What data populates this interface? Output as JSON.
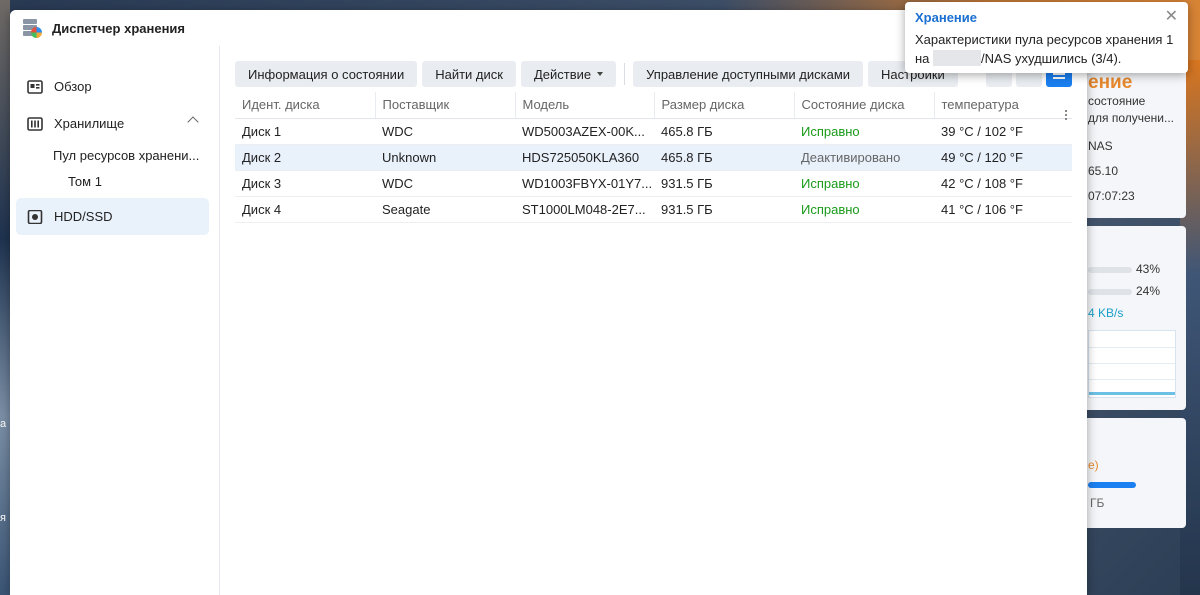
{
  "window": {
    "title": "Диспетчер хранения"
  },
  "sidebar": {
    "items": [
      {
        "label": "Обзор"
      },
      {
        "label": "Хранилище"
      },
      {
        "label": "Пул ресурсов хранени..."
      },
      {
        "label": "Том 1"
      },
      {
        "label": "HDD/SSD"
      }
    ]
  },
  "toolbar": {
    "status_info": "Информация о состоянии",
    "find_disk": "Найти диск",
    "action": "Действие",
    "manage_disks": "Управление доступными дисками",
    "settings": "Настройки"
  },
  "table": {
    "headers": [
      "Идент. диска",
      "Поставщик",
      "Модель",
      "Размер диска",
      "Состояние диска",
      "температура"
    ],
    "rows": [
      {
        "id": "Диск 1",
        "vendor": "WDC",
        "model": "WD5003AZEX-00K...",
        "size": "465.8 ГБ",
        "status": "Исправно",
        "temp": "39 °C / 102 °F"
      },
      {
        "id": "Диск 2",
        "vendor": "Unknown",
        "model": "HDS725050KLA360",
        "size": "465.8 ГБ",
        "status": "Деактивировано",
        "temp": "49 °C / 120 °F"
      },
      {
        "id": "Диск 3",
        "vendor": "WDC",
        "model": "WD1003FBYX-01Y7...",
        "size": "931.5 ГБ",
        "status": "Исправно",
        "temp": "42 °C / 108 °F"
      },
      {
        "id": "Диск 4",
        "vendor": "Seagate",
        "model": "ST1000LM048-2E7...",
        "size": "931.5 ГБ",
        "status": "Исправно",
        "temp": "41 °C / 106 °F"
      }
    ]
  },
  "notification": {
    "title": "Хранение",
    "line1": "Характеристики пула ресурсов хранения 1",
    "line2_prefix": "на",
    "line2_suffix": "/NAS ухудшились (3/4)."
  },
  "background_widget": {
    "title_fragment": "ение",
    "lines": [
      "состояние",
      "для получени...",
      "NAS",
      "65.10",
      "07:07:23"
    ],
    "cpu_percent": "43%",
    "ram_percent": "24%",
    "speed": "4 KB/s",
    "paren": "e)",
    "size_fragment": "ГБ"
  },
  "colors": {
    "accent": "#1a7ff0",
    "healthy": "#1a9b1a",
    "selected_row": "#e9f1fb",
    "notif_title": "#1a6fd0"
  }
}
